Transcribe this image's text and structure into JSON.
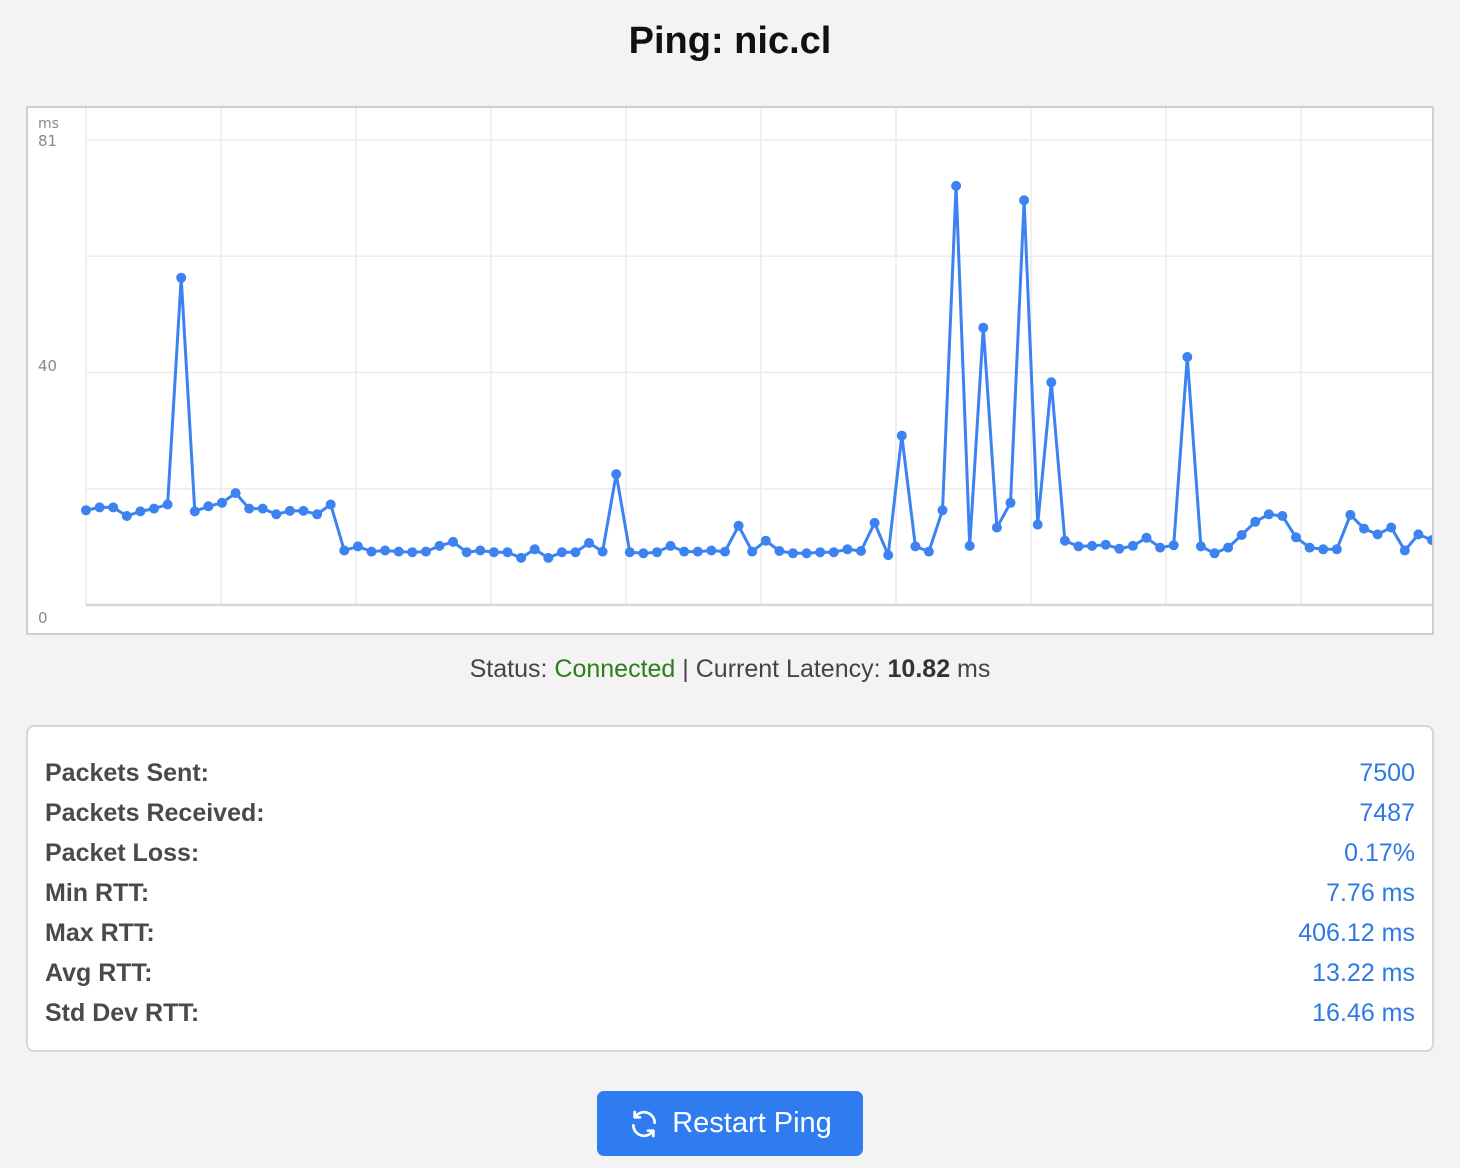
{
  "page": {
    "title": "Ping: nic.cl"
  },
  "chart_data": {
    "type": "line",
    "title": "",
    "xlabel": "",
    "ylabel": "ms",
    "ylim": [
      0,
      81
    ],
    "yticks": [
      "81",
      "40",
      "0"
    ],
    "series_color": "#3c82f0",
    "grid": true,
    "series": [
      {
        "values": [
          16.5,
          17,
          17,
          15.5,
          16.3,
          16.8,
          17.5,
          57,
          16.3,
          17.2,
          17.8,
          19.5,
          16.8,
          16.8,
          15.8,
          16.4,
          16.4,
          15.8,
          17.5,
          9.5,
          10.2,
          9.3,
          9.5,
          9.3,
          9.2,
          9.3,
          10.3,
          11,
          9.2,
          9.5,
          9.2,
          9.2,
          8.2,
          9.7,
          8.2,
          9.2,
          9.2,
          10.8,
          9.3,
          22.8,
          9.2,
          9,
          9.2,
          10.3,
          9.3,
          9.3,
          9.5,
          9.3,
          13.8,
          9.3,
          11.2,
          9.4,
          9,
          9,
          9.2,
          9.2,
          9.7,
          9.4,
          14.3,
          8.7,
          29.5,
          10.2,
          9.3,
          16.5,
          73,
          10.3,
          48.3,
          13.5,
          17.8,
          70.5,
          14,
          38.8,
          11.2,
          10.2,
          10.3,
          10.5,
          9.8,
          10.3,
          11.7,
          10,
          10.4,
          43.2,
          10.2,
          9,
          10,
          12.2,
          14.5,
          15.8,
          15.5,
          11.8,
          10,
          9.7,
          9.7,
          15.7,
          13.3,
          12.3,
          13.5,
          9.5,
          12.3,
          11.3
        ]
      }
    ]
  },
  "status": {
    "label": "Status:",
    "value": "Connected",
    "separator": "|",
    "latency_label": "Current Latency:",
    "latency_value": "10.82",
    "latency_unit": "ms",
    "connected_color": "#2e7d1e"
  },
  "stats": {
    "rows": [
      {
        "label": "Packets Sent:",
        "value": "7500"
      },
      {
        "label": "Packets Received:",
        "value": "7487"
      },
      {
        "label": "Packet Loss:",
        "value": "0.17%"
      },
      {
        "label": "Min RTT:",
        "value": "7.76 ms"
      },
      {
        "label": "Max RTT:",
        "value": "406.12 ms"
      },
      {
        "label": "Avg RTT:",
        "value": "13.22 ms"
      },
      {
        "label": "Std Dev RTT:",
        "value": "16.46 ms"
      }
    ],
    "value_color": "#2d7ae5"
  },
  "restart": {
    "label": "Restart Ping",
    "icon": "refresh-icon",
    "color": "#2f7cf0"
  }
}
